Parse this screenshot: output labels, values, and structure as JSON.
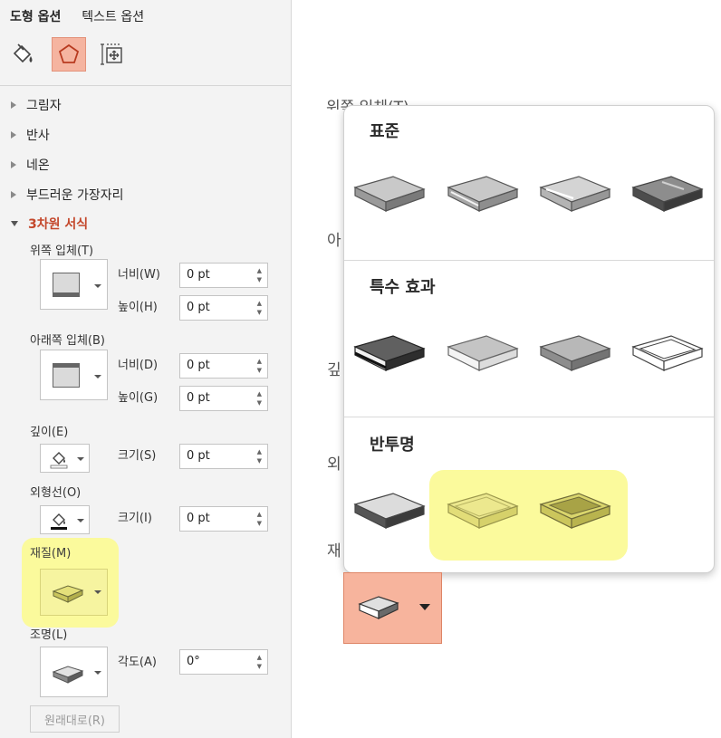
{
  "tabs": {
    "shape_options": "도형 옵션",
    "text_options": "텍스트 옵션"
  },
  "sections": {
    "shadow": "그림자",
    "reflection": "반사",
    "glow": "네온",
    "soft_edges": "부드러운 가장자리",
    "format_3d": "3차원 서식"
  },
  "bevel_top": {
    "label": "위쪽 입체(T)",
    "width_label": "너비(W)",
    "width_value": "0 pt",
    "height_label": "높이(H)",
    "height_value": "0 pt"
  },
  "bevel_bottom": {
    "label": "아래쪽 입체(B)",
    "width_label": "너비(D)",
    "width_value": "0 pt",
    "height_label": "높이(G)",
    "height_value": "0 pt"
  },
  "depth": {
    "label": "깊이(E)",
    "size_label": "크기(S)",
    "size_value": "0 pt"
  },
  "contour": {
    "label": "외형선(O)",
    "size_label": "크기(I)",
    "size_value": "0 pt"
  },
  "material": {
    "label": "재질(M)"
  },
  "lighting": {
    "label": "조명(L)",
    "angle_label": "각도(A)",
    "angle_value": "0°"
  },
  "reset_label": "원래대로(R)",
  "gallery": {
    "ghost_labels": {
      "top": "위쪽 입체(T)",
      "bottom": "아",
      "depth": "깊",
      "contour": "외",
      "material": "재"
    },
    "groups": [
      {
        "title": "표준"
      },
      {
        "title": "특수 효과"
      },
      {
        "title": "반투명"
      }
    ]
  },
  "colors": {
    "accent": "#c4472b",
    "selected_bg": "#f5b4a0",
    "highlight": "#fbfa9c"
  },
  "icons": [
    "fill-line-icon",
    "effects-pentagon-icon",
    "size-properties-icon",
    "material-swatch-icon"
  ]
}
